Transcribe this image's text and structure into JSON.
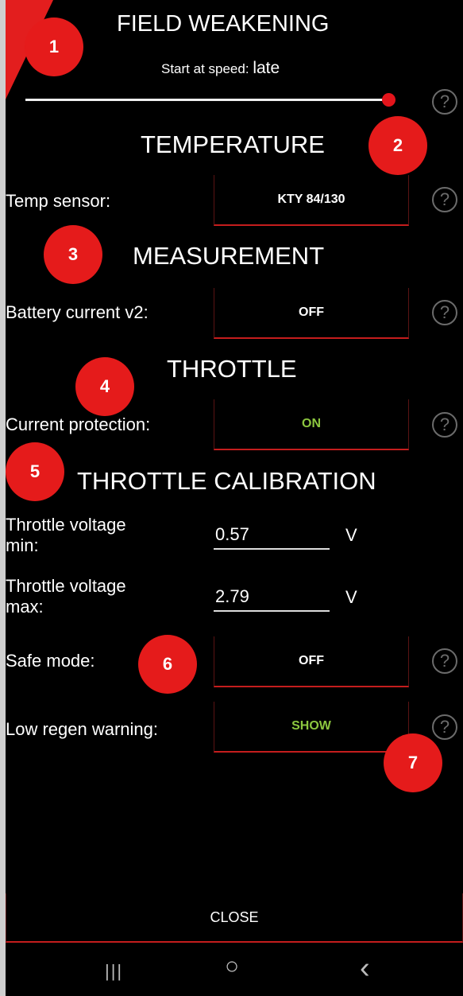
{
  "field_weakening": {
    "title": "FIELD WEAKENING",
    "start_label": "Start at speed:",
    "start_value": "late",
    "slider_level": 1.0,
    "slider_color": "#e3141b"
  },
  "temperature": {
    "title": "TEMPERATURE",
    "sensor_label": "Temp sensor:",
    "sensor_value": "KTY 84/130"
  },
  "measurement": {
    "title": "MEASUREMENT",
    "battery_label": "Battery current v2:",
    "battery_value": "OFF"
  },
  "throttle": {
    "title": "THROTTLE",
    "protection_label": "Current protection:",
    "protection_value": "ON"
  },
  "throttle_calibration": {
    "title": "THROTTLE CALIBRATION",
    "vmin_label_1": "Throttle voltage",
    "vmin_label_2": "min:",
    "vmin_value": "0.57",
    "vmin_unit": "V",
    "vmax_label_1": "Throttle voltage",
    "vmax_label_2": "max:",
    "vmax_value": "2.79",
    "vmax_unit": "V",
    "safe_label": "Safe mode:",
    "safe_value": "OFF",
    "regen_label": "Low regen warning:",
    "regen_value": "SHOW"
  },
  "help_icon": "?",
  "badges": [
    "1",
    "2",
    "3",
    "4",
    "5",
    "6",
    "7"
  ],
  "close_label": "CLOSE",
  "nav": {
    "recents": "|||",
    "home": "○",
    "back": "‹"
  },
  "colors": {
    "accent": "#e51b1b",
    "on_green": "#8cc63f",
    "background": "#000000"
  }
}
